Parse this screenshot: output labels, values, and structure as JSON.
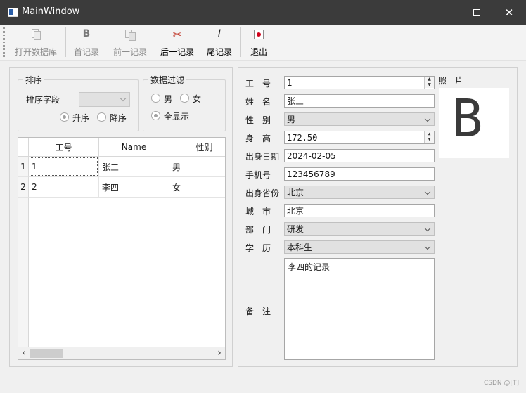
{
  "window": {
    "title": "MainWindow",
    "minimize_glyph": "—",
    "maximize_glyph": "☐",
    "close_glyph": "✕"
  },
  "toolbar": {
    "items": [
      {
        "label": "打开数据库",
        "icon": "open-database-icon",
        "enabled": false
      },
      {
        "label": "首记录",
        "icon": "first-record-icon",
        "glyph": "B",
        "enabled": false
      },
      {
        "label": "前一记录",
        "icon": "previous-record-icon",
        "enabled": false
      },
      {
        "label": "后一记录",
        "icon": "next-record-icon",
        "enabled": true
      },
      {
        "label": "尾记录",
        "icon": "last-record-icon",
        "glyph": "I",
        "enabled": true
      },
      {
        "label": "退出",
        "icon": "exit-icon",
        "enabled": true
      }
    ]
  },
  "sort_group": {
    "title": "排序",
    "field_label": "排序字段",
    "field_value": "",
    "asc_label": "升序",
    "desc_label": "降序",
    "selected": "asc"
  },
  "filter_group": {
    "title": "数据过滤",
    "male_label": "男",
    "female_label": "女",
    "all_label": "全显示",
    "selected": "all"
  },
  "table": {
    "columns": [
      "工号",
      "Name",
      "性别"
    ],
    "rows": [
      {
        "header": "1",
        "cells": [
          "1",
          "张三",
          "男"
        ]
      },
      {
        "header": "2",
        "cells": [
          "2",
          "李四",
          "女"
        ]
      }
    ],
    "scroll_left_glyph": "‹",
    "scroll_right_glyph": "›"
  },
  "form": {
    "id_label": "工　号",
    "id_value": "1",
    "name_label": "姓　名",
    "name_value": "张三",
    "gender_label": "性　别",
    "gender_value": "男",
    "height_label": "身　高",
    "height_value": "172.50",
    "birthday_label": "出身日期",
    "birthday_value": "2024-02-05",
    "phone_label": "手机号",
    "phone_value": "123456789",
    "province_label": "出身省份",
    "province_value": "北京",
    "city_label": "城　市",
    "city_value": "北京",
    "dept_label": "部　门",
    "dept_value": "研发",
    "education_label": "学　历",
    "education_value": "本科生",
    "memo_label": "备　注",
    "memo_value": "李四的记录",
    "photo_label": "照　片",
    "photo_glyph": "B"
  },
  "watermark": "CSDN @[T]",
  "colors": {
    "titlebar": "#3b3b3b",
    "window_bg": "#f0f0f0",
    "exit_red": "#d0021b"
  }
}
